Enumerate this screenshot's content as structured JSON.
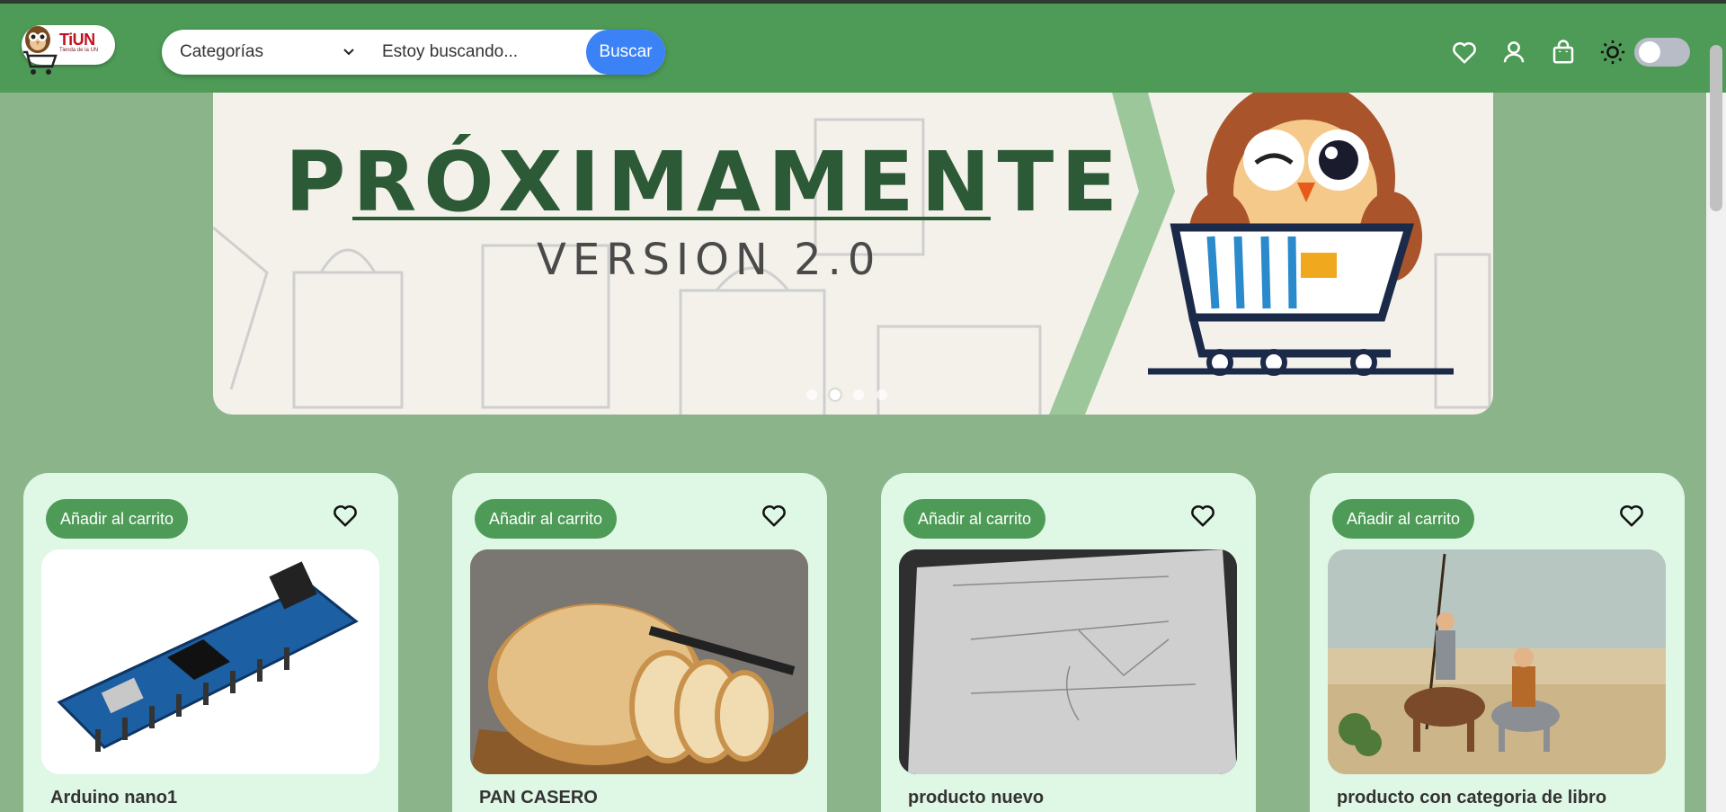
{
  "header": {
    "logo_text": "TiUN",
    "logo_subtitle": "Tienda de la UN",
    "category_select": "Categorías",
    "search_placeholder": "Estoy buscando...",
    "search_button": "Buscar",
    "icons": [
      "heart-icon",
      "user-icon",
      "shopping-bag-icon",
      "sun-icon"
    ],
    "theme_toggle": "off"
  },
  "banner": {
    "title": "PRÓXIMAMENTE",
    "subtitle": "VERSION 2.0",
    "slides": 4,
    "active_slide": 2
  },
  "products": [
    {
      "add_label": "Añadir al carrito",
      "name": "Arduino nano1",
      "image": "arduino-board"
    },
    {
      "add_label": "Añadir al carrito",
      "name": "PAN CASERO",
      "image": "bread"
    },
    {
      "add_label": "Añadir al carrito",
      "name": "producto nuevo",
      "image": "sketch-paper"
    },
    {
      "add_label": "Añadir al carrito",
      "name": "producto con categoria de libro",
      "image": "don-quixote"
    }
  ],
  "colors": {
    "navbar": "#4e9b57",
    "page_bg": "#8cb48b",
    "card_bg": "#dff7e5",
    "search_button": "#3b82f6"
  }
}
